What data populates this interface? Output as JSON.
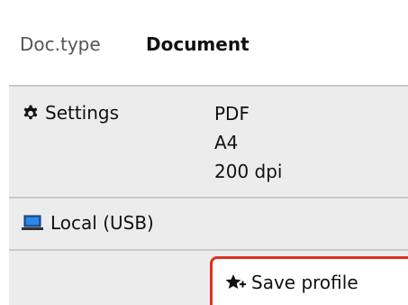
{
  "doc_type": {
    "label": "Doc.type",
    "value": "Document"
  },
  "settings": {
    "label": "Settings",
    "icon": "gear-icon",
    "values": [
      "PDF",
      "A4",
      "200 dpi"
    ]
  },
  "destination": {
    "label": "Local (USB)",
    "icon": "laptop-icon"
  },
  "save_profile": {
    "label": "Save profile",
    "icon": "star-plus-icon",
    "highlight_color": "#e0301e"
  }
}
